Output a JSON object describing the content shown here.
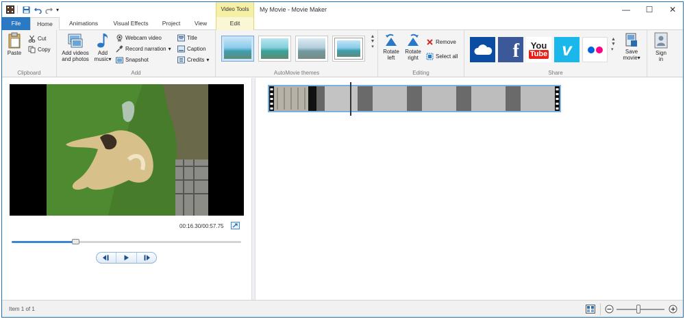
{
  "window": {
    "title": "My Movie - Movie Maker",
    "context_header": "Video Tools",
    "controls": {
      "minimize": "—",
      "maximize": "☐",
      "close": "✕"
    }
  },
  "tabs": [
    {
      "label": "File"
    },
    {
      "label": "Home"
    },
    {
      "label": "Animations"
    },
    {
      "label": "Visual Effects"
    },
    {
      "label": "Project"
    },
    {
      "label": "View"
    },
    {
      "label": "Edit"
    }
  ],
  "ribbon": {
    "clipboard": {
      "label": "Clipboard",
      "paste": "Paste",
      "cut": "Cut",
      "copy": "Copy"
    },
    "add": {
      "label": "Add",
      "add_videos_line1": "Add videos",
      "add_videos_line2": "and photos",
      "add_music_line1": "Add",
      "add_music_line2": "music",
      "webcam_video": "Webcam video",
      "record_narration": "Record narration",
      "snapshot": "Snapshot",
      "title": "Title",
      "caption": "Caption",
      "credits": "Credits"
    },
    "themes": {
      "label": "AutoMovie themes",
      "count": 4
    },
    "editing": {
      "label": "Editing",
      "rotate_left_line1": "Rotate",
      "rotate_left_line2": "left",
      "rotate_right_line1": "Rotate",
      "rotate_right_line2": "right",
      "remove": "Remove",
      "select_all": "Select all"
    },
    "share": {
      "label": "Share",
      "services": [
        {
          "name": "onedrive-icon",
          "color": "#0a4da2"
        },
        {
          "name": "facebook-icon",
          "color": "#3b5998",
          "glyph": "f"
        },
        {
          "name": "youtube-icon",
          "color": "#ffffff",
          "glyph_top": "You",
          "glyph_bottom": "Tube"
        },
        {
          "name": "vimeo-icon",
          "color": "#1ab7ea",
          "glyph": "v"
        },
        {
          "name": "flickr-icon",
          "color": "#ffffff"
        }
      ],
      "save_movie_line1": "Save",
      "save_movie_line2": "movie",
      "sign_in_line1": "Sign",
      "sign_in_line2": "in"
    }
  },
  "player": {
    "timecode": "00:16.30/00:57.75",
    "progress_fraction": 0.28
  },
  "status": {
    "text": "Item 1 of 1",
    "zoom_fraction": 0.45
  },
  "colors": {
    "file_tab": "#2b79c2",
    "accent": "#3a86d1",
    "context_tab": "#f6f0a6"
  }
}
